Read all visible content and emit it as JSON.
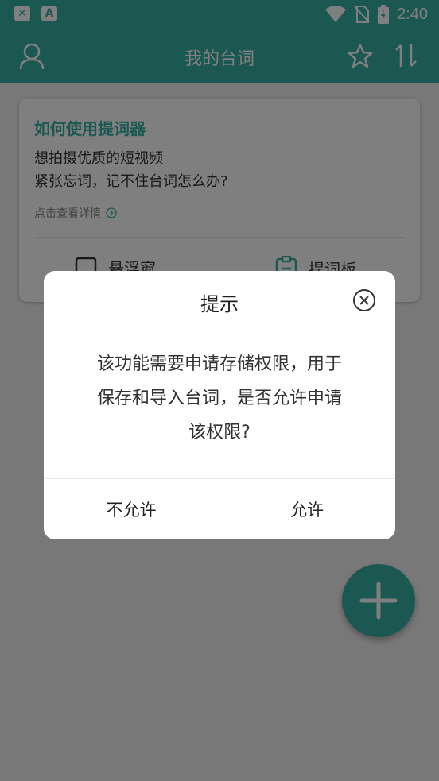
{
  "status_bar": {
    "time": "2:40",
    "notif_app_label": "A"
  },
  "app_bar": {
    "title": "我的台词"
  },
  "card": {
    "title": "如何使用提词器",
    "line1": "想拍摄优质的短视频",
    "line2": "紧张忘词，记不住台词怎么办?",
    "link": "点击查看详情",
    "button_left": "悬浮窗",
    "button_right": "提词板"
  },
  "dialog": {
    "title": "提示",
    "message_lines": [
      "该功能需要申请存储权限，用于",
      "保存和导入台词，是否允许申请",
      "该权限?"
    ],
    "deny_label": "不允许",
    "allow_label": "允许"
  },
  "colors": {
    "accent": "#39b1a4",
    "overlay": "rgba(0,0,0,0.5)"
  }
}
